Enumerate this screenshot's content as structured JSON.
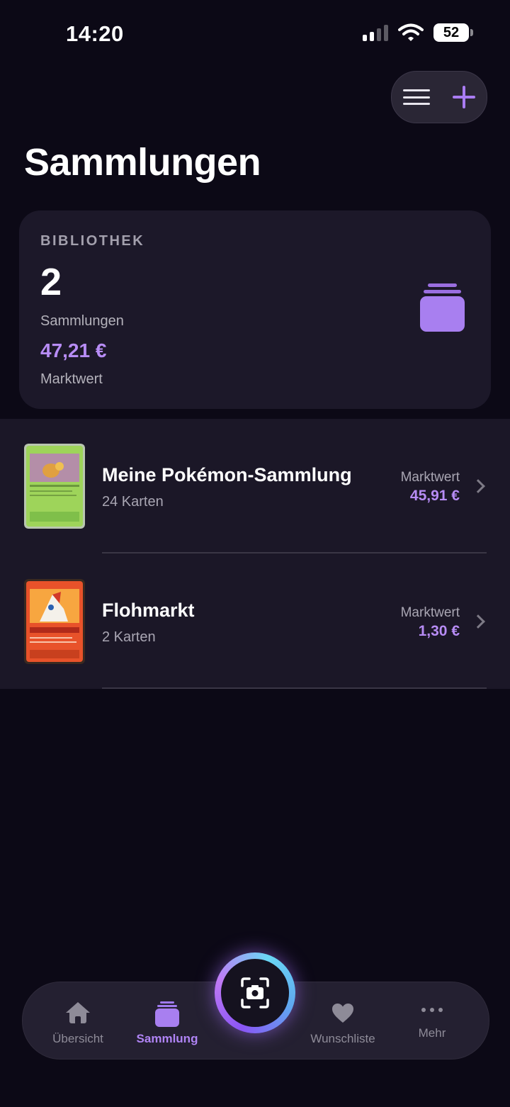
{
  "status_bar": {
    "time": "14:20",
    "battery": "52"
  },
  "header": {
    "title": "Sammlungen"
  },
  "top_actions": {
    "menu_icon": "hamburger-menu-icon",
    "add_icon": "plus-icon",
    "accent": "#a97cf2"
  },
  "library": {
    "label": "BIBLIOTHEK",
    "count": "2",
    "count_label": "Sammlungen",
    "value": "47,21 €",
    "value_label": "Marktwert",
    "icon": "stack-icon"
  },
  "collections": [
    {
      "name": "Meine Pokémon-Sammlung",
      "count": "24 Karten",
      "value_label": "Marktwert",
      "value": "45,91 €",
      "card_color": "#8fcf4a"
    },
    {
      "name": "Flohmarkt",
      "count": "2 Karten",
      "value_label": "Marktwert",
      "value": "1,30 €",
      "card_color": "#e8522a"
    }
  ],
  "tabs": [
    {
      "label": "Übersicht",
      "icon": "home-icon",
      "active": false
    },
    {
      "label": "Sammlung",
      "icon": "stack-icon",
      "active": true
    },
    {
      "label": "Wunschliste",
      "icon": "heart-icon",
      "active": false
    },
    {
      "label": "Mehr",
      "icon": "more-dots-icon",
      "active": false
    }
  ],
  "scan_button": {
    "icon": "camera-scan-icon"
  },
  "colors": {
    "background": "#0c0916",
    "accent": "#b78cf5",
    "card": "#1c1829"
  }
}
